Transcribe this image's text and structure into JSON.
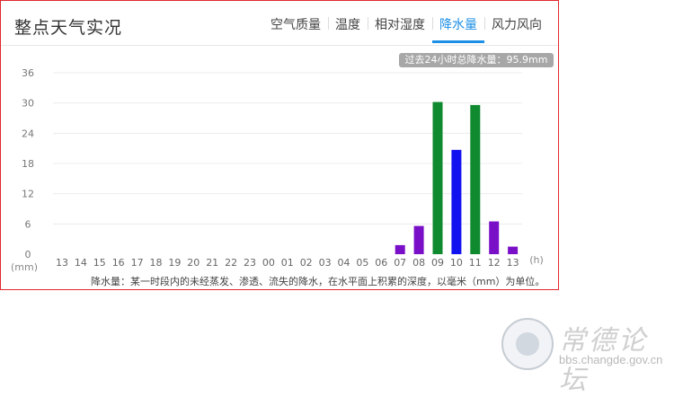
{
  "panel": {
    "title": "整点天气实况",
    "tabs": [
      {
        "label": "空气质量",
        "active": false
      },
      {
        "label": "温度",
        "active": false
      },
      {
        "label": "相对湿度",
        "active": false
      },
      {
        "label": "降水量",
        "active": true
      },
      {
        "label": "风力风向",
        "active": false
      }
    ],
    "total_badge": "过去24小时总降水量：95.9mm",
    "footnote": "降水量：某一时段内的未经蒸发、渗透、流失的降水，在水平面上积累的深度，以毫米（mm）为单位。"
  },
  "colors": {
    "accent": "#1e8fe6",
    "border": "#e0282e",
    "bar_green": "#0f8a2f",
    "bar_blue": "#1212f0",
    "bar_purple": "#7a0fc8"
  },
  "chart_data": {
    "type": "bar",
    "categories": [
      "13",
      "14",
      "15",
      "16",
      "17",
      "18",
      "19",
      "20",
      "21",
      "22",
      "23",
      "00",
      "01",
      "02",
      "03",
      "04",
      "05",
      "06",
      "07",
      "08",
      "09",
      "10",
      "11",
      "12",
      "13"
    ],
    "values": [
      0,
      0,
      0,
      0,
      0,
      0,
      0,
      0,
      0,
      0,
      0,
      0,
      0,
      0,
      0,
      0,
      0,
      0,
      1.8,
      5.6,
      30.2,
      20.7,
      29.6,
      6.5,
      1.5
    ],
    "bar_colors": [
      "purple",
      "purple",
      "purple",
      "purple",
      "purple",
      "purple",
      "purple",
      "purple",
      "purple",
      "purple",
      "purple",
      "purple",
      "purple",
      "purple",
      "purple",
      "purple",
      "purple",
      "purple",
      "purple",
      "purple",
      "green",
      "blue",
      "green",
      "purple",
      "purple"
    ],
    "yticks": [
      0,
      6,
      12,
      18,
      24,
      30,
      36
    ],
    "ylim": [
      0,
      36
    ],
    "ylabel": "(mm)",
    "xlabel": "(h)",
    "grid": true
  },
  "watermark": {
    "name": "常德论坛",
    "url": "bbs.changde.gov.cn"
  }
}
